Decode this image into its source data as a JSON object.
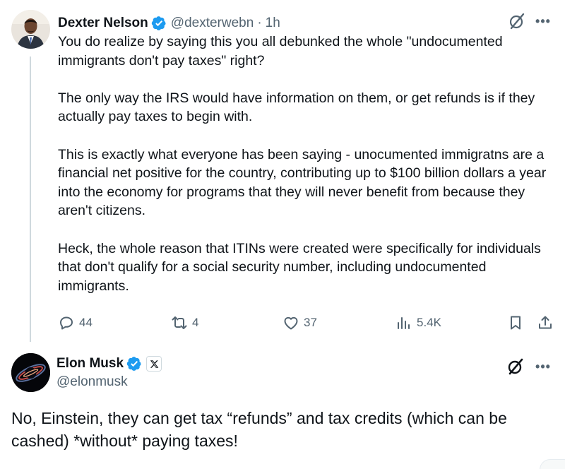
{
  "reply_tweet": {
    "author_name": "Dexter Nelson",
    "handle": "@dexterwebn",
    "separator": "·",
    "time": "1h",
    "icons": {
      "verified": "verified-badge-icon",
      "grok": "grok-icon",
      "more": "more-icon"
    },
    "text": "You do realize by saying this you all debunked the whole \"undocumented immigrants don't pay taxes\" right?\n\nThe only way the IRS would have information on them, or get refunds is if they actually pay taxes to begin with.\n\nThis is exactly what everyone has been saying - unocumented immigratns are a financial net positive for the country, contributing up to $100 billion dollars a year into the economy for programs that they will never benefit from because they aren't citizens.\n\nHeck, the whole reason that ITINs were created were specifically for individuals that don't qualify for a social security number, including undocumented immigrants.",
    "actions": {
      "replies": "44",
      "retweets": "4",
      "likes": "37",
      "views": "5.4K"
    }
  },
  "main_tweet": {
    "author_name": "Elon Musk",
    "handle": "@elonmusk",
    "icons": {
      "verified": "verified-badge-icon",
      "affiliate": "x-logo-icon",
      "grok": "grok-icon",
      "more": "more-icon"
    },
    "text": "No, Einstein, they can get tax “refunds” and tax credits (which can be cashed) *without* paying taxes!"
  },
  "colors": {
    "text": "#0f1419",
    "muted": "#536471",
    "verified": "#1d9bf0",
    "thread_line": "#cfd9de"
  }
}
